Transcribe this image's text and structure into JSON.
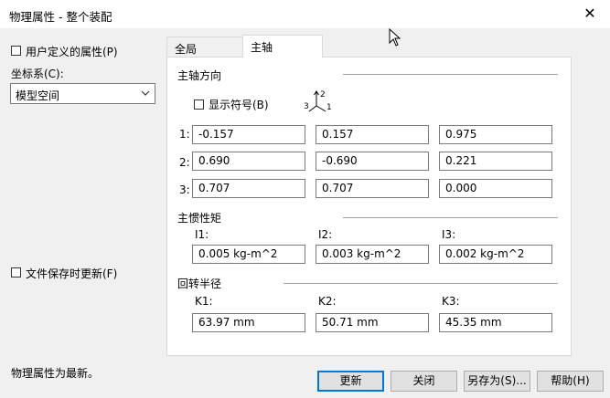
{
  "window": {
    "title": "物理属性 - 整个装配"
  },
  "left": {
    "user_defined_label": "用户定义的属性(P)",
    "coord_label": "坐标系(C):",
    "coord_value": "模型空间",
    "update_on_save_label": "文件保存时更新(F)",
    "status": "物理属性为最新。"
  },
  "tabs": [
    {
      "label": "全局",
      "selected": false
    },
    {
      "label": "主轴",
      "selected": true
    }
  ],
  "principal_axes": {
    "section_label": "主轴方向",
    "show_symbol_label": "显示符号(B)",
    "triad_labels": [
      "2",
      "3",
      "1"
    ],
    "rows": [
      {
        "label": "1:",
        "values": [
          "-0.157",
          "0.157",
          "0.975"
        ]
      },
      {
        "label": "2:",
        "values": [
          "0.690",
          "-0.690",
          "0.221"
        ]
      },
      {
        "label": "3:",
        "values": [
          "0.707",
          "0.707",
          "0.000"
        ]
      }
    ]
  },
  "moments": {
    "section_label": "主惯性矩",
    "items": [
      {
        "label": "I1:",
        "value": "0.005 kg-m^2"
      },
      {
        "label": "I2:",
        "value": "0.003 kg-m^2"
      },
      {
        "label": "I3:",
        "value": "0.002 kg-m^2"
      }
    ]
  },
  "radii": {
    "section_label": "回转半径",
    "items": [
      {
        "label": "K1:",
        "value": "63.97 mm"
      },
      {
        "label": "K2:",
        "value": "50.71 mm"
      },
      {
        "label": "K3:",
        "value": "45.35 mm"
      }
    ]
  },
  "buttons": {
    "update": "更新",
    "close": "关闭",
    "save_as": "另存为(S)...",
    "help": "帮助(H)"
  }
}
